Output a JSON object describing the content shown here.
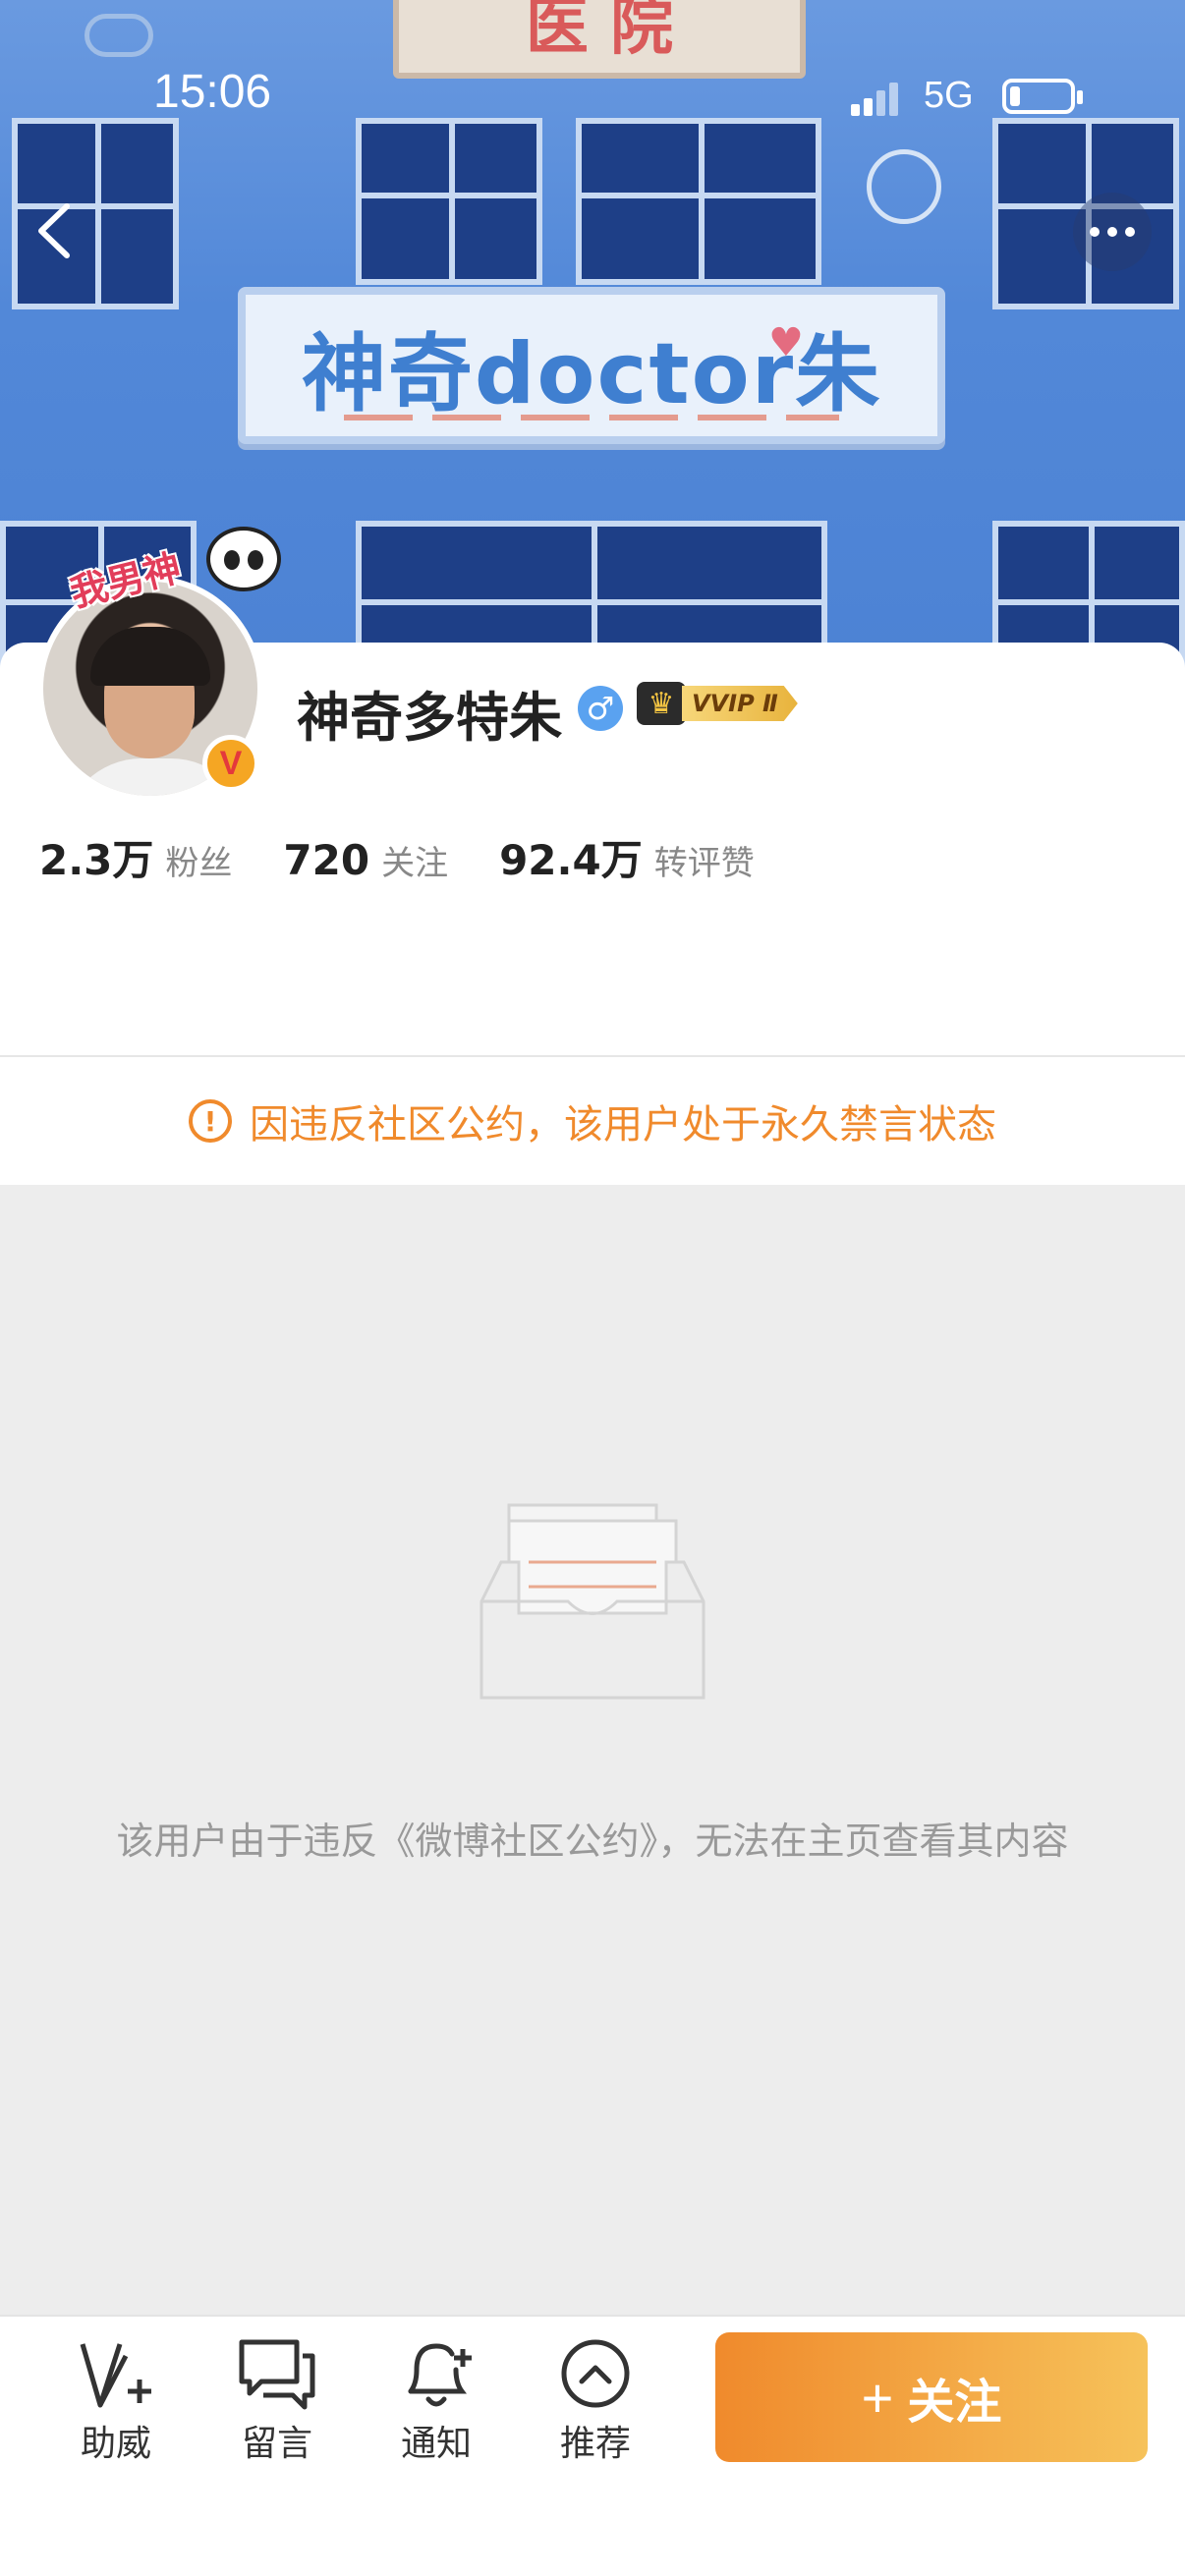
{
  "status_bar": {
    "time": "15:06",
    "network": "5G"
  },
  "banner": {
    "top_sign_text": "医   院",
    "main_sign_text": "神奇doctor朱",
    "heart_text": "¥"
  },
  "header": {
    "back_icon": "chevron-left-icon",
    "more_icon": "more-dots-icon"
  },
  "profile": {
    "avatar_pendant_text": "我男神",
    "verified_badge": "V",
    "username": "神奇多特朱",
    "gender_symbol": "♂",
    "vip_label": "VVIP Ⅱ",
    "stats": [
      {
        "value": "2.3万",
        "label": "粉丝"
      },
      {
        "value": "720",
        "label": "关注"
      },
      {
        "value": "92.4万",
        "label": "转评赞"
      }
    ]
  },
  "notice": {
    "icon": "!",
    "text": "因违反社区公约，该用户处于永久禁言状态"
  },
  "empty_state": {
    "message": "该用户由于违反《微博社区公约》，无法在主页查看其内容"
  },
  "bottom_bar": {
    "tools": [
      {
        "label": "助威",
        "icon": "v-plus-icon"
      },
      {
        "label": "留言",
        "icon": "message-icon"
      },
      {
        "label": "通知",
        "icon": "bell-plus-icon"
      },
      {
        "label": "推荐",
        "icon": "chevron-up-circle-icon"
      }
    ],
    "follow_plus": "+",
    "follow_label": "关注"
  },
  "colors": {
    "accent": "#f08a2c",
    "accent_light": "#f6c25a",
    "banner_blue": "#5288d8",
    "text_muted": "#999999"
  }
}
